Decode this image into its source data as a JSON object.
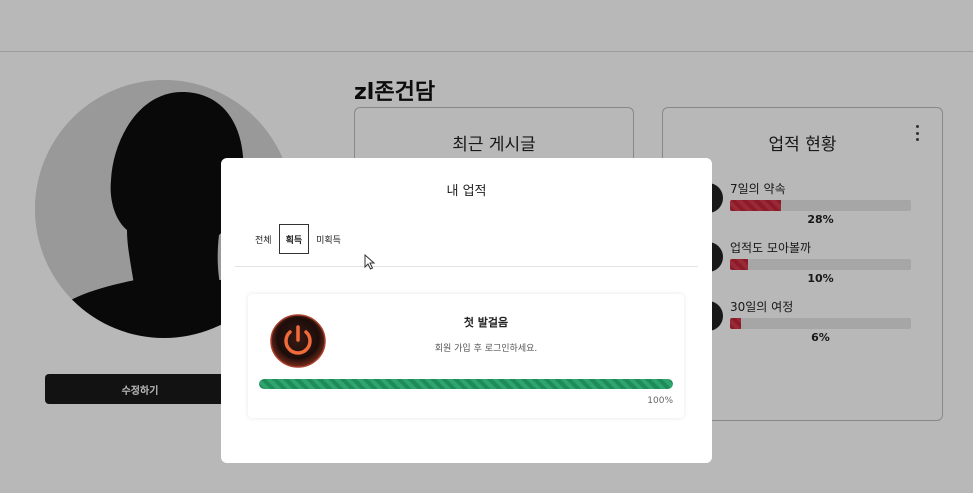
{
  "profile": {
    "username": "zl존건담",
    "edit_label": "수정하기"
  },
  "posts_card": {
    "title": "최근 게시글"
  },
  "achievements_card": {
    "title": "업적 현황",
    "items": [
      {
        "name": "7일의 약속",
        "percent_label": "28%",
        "progress": 0.28
      },
      {
        "name": "업적도 모아볼까",
        "percent_label": "10%",
        "progress": 0.1
      },
      {
        "name": "30일의 여정",
        "percent_label": "6%",
        "progress": 0.06
      }
    ]
  },
  "modal": {
    "title": "내 업적",
    "tabs": [
      {
        "label": "전체",
        "active": false
      },
      {
        "label": "획득",
        "active": true
      },
      {
        "label": "미획득",
        "active": false
      }
    ],
    "achievement": {
      "name": "첫 발걸음",
      "description": "회원 가입 후 로그인하세요.",
      "percent_label": "100%",
      "progress": 1.0,
      "icon": "power-icon"
    }
  },
  "colors": {
    "progress_red": "#c2263a",
    "progress_green": "#1f8a5a",
    "button_dark": "#1a1a1a"
  }
}
